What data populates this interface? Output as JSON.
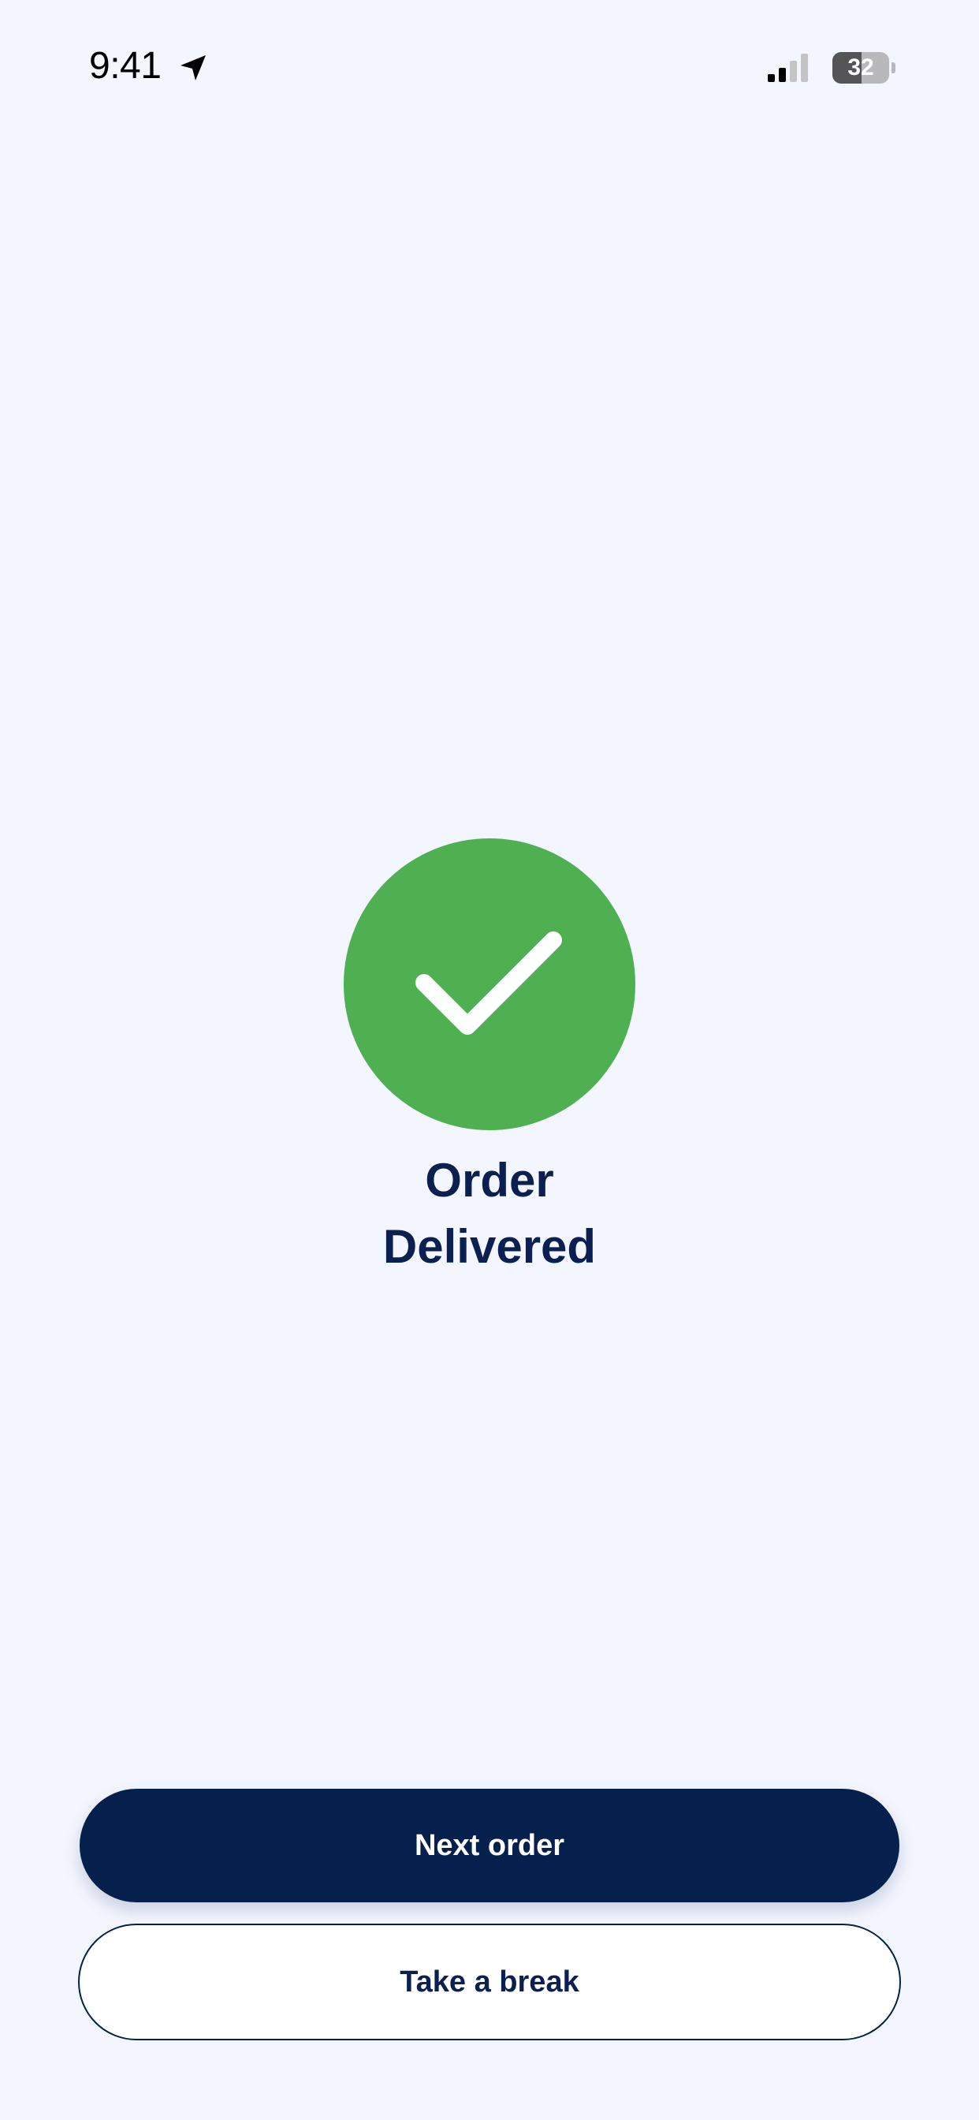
{
  "status_bar": {
    "time": "9:41",
    "battery_level": "32",
    "battery_fraction": 0.32,
    "signal_bars_active": 2,
    "signal_bars_total": 4,
    "icons": [
      "location-arrow-icon",
      "cellular-signal-icon",
      "battery-icon"
    ]
  },
  "confirmation": {
    "icon": "checkmark-icon",
    "title_line1": "Order",
    "title_line2": "Delivered"
  },
  "actions": {
    "primary_label": "Next order",
    "secondary_label": "Take a break"
  },
  "colors": {
    "background": "#F4F6FF",
    "success": "#4FB051",
    "primary": "#05204C",
    "text_dark": "#0B2050"
  }
}
